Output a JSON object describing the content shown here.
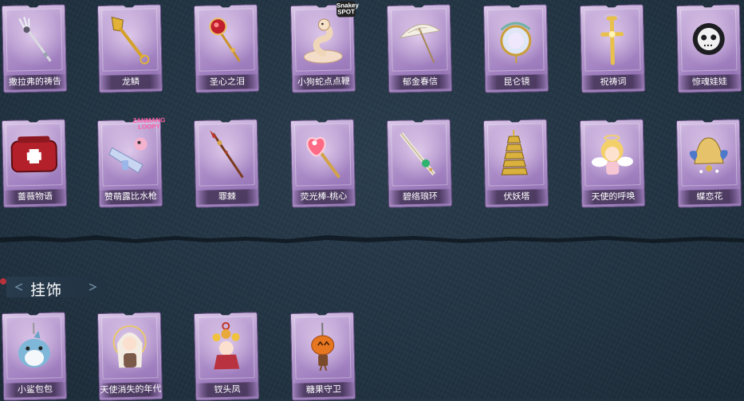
{
  "rows": [
    {
      "items": [
        {
          "label": "撒拉弗的祷告",
          "icon": "trident-staff-icon"
        },
        {
          "label": "龙鳞",
          "icon": "golden-shovel-icon"
        },
        {
          "label": "圣心之泪",
          "icon": "ruby-heart-scepter-icon"
        },
        {
          "label": "小狗蛇点点鞭",
          "icon": "snake-whip-icon",
          "badge": "Snakey SPOT"
        },
        {
          "label": "郁金春信",
          "icon": "paper-umbrella-icon"
        },
        {
          "label": "昆仑镜",
          "icon": "jade-mirror-icon"
        },
        {
          "label": "祝祷词",
          "icon": "golden-cross-icon"
        },
        {
          "label": "惊魂娃娃",
          "icon": "skull-doll-icon"
        }
      ]
    },
    {
      "items": [
        {
          "label": "蔷薇物语",
          "icon": "red-case-icon"
        },
        {
          "label": "赞萌露比水枪",
          "icon": "water-gun-icon",
          "badge": "ZANMANG LOOPY"
        },
        {
          "label": "罪棘",
          "icon": "thorn-spear-icon"
        },
        {
          "label": "荧光棒-桃心",
          "icon": "heart-glowstick-icon"
        },
        {
          "label": "碧络琅环",
          "icon": "jade-blade-icon"
        },
        {
          "label": "伏妖塔",
          "icon": "golden-pagoda-icon"
        },
        {
          "label": "天使的呼唤",
          "icon": "angel-doll-icon"
        },
        {
          "label": "蝶恋花",
          "icon": "butterfly-bell-icon"
        }
      ]
    }
  ],
  "section": {
    "title": "挂饰"
  },
  "pendants": [
    {
      "label": "小鲨包包",
      "icon": "shark-bag-icon"
    },
    {
      "label": "天使消失的年代",
      "icon": "angel-girl-icon"
    },
    {
      "label": "钗头凤",
      "icon": "flower-crown-icon"
    },
    {
      "label": "糖果守卫",
      "icon": "pumpkin-guard-icon"
    }
  ]
}
